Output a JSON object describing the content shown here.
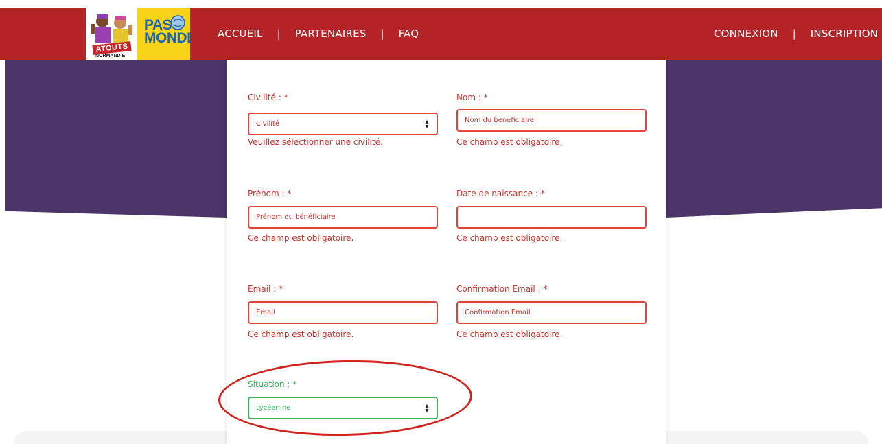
{
  "nav": {
    "left": [
      "ACCUEIL",
      "PARTENAIRES",
      "FAQ"
    ],
    "right": [
      "CONNEXION",
      "INSCRIPTION"
    ],
    "separator": "|"
  },
  "logos": {
    "atouts": "ATOUTS",
    "normandie": "NORMANDIE",
    "pass_line1": "PASS",
    "pass_line2": "MONDE"
  },
  "form": {
    "civilite": {
      "label": "Civilité : *",
      "value": "Civilité",
      "error": "Veuillez sélectionner une civilité."
    },
    "nom": {
      "label": "Nom : *",
      "placeholder": "Nom du bénéficiaire",
      "error": "Ce champ est obligatoire."
    },
    "prenom": {
      "label": "Prénom : *",
      "placeholder": "Prénom du bénéficiaire",
      "error": "Ce champ est obligatoire."
    },
    "naissance": {
      "label": "Date de naissance : *",
      "value": "",
      "error": "Ce champ est obligatoire."
    },
    "email": {
      "label": "Email : *",
      "placeholder": "Email",
      "error": "Ce champ est obligatoire."
    },
    "email_confirm": {
      "label": "Confirmation Email : *",
      "placeholder": "Confirmation Email",
      "error": "Ce champ est obligatoire."
    },
    "situation": {
      "label": "Situation : *",
      "value": "Lycéen.ne"
    }
  },
  "colors": {
    "header_red": "#b52326",
    "banner_purple": "#4a3468",
    "error_red": "#c8372f",
    "valid_green": "#3fb35d",
    "logo_yellow": "#f7d417"
  }
}
